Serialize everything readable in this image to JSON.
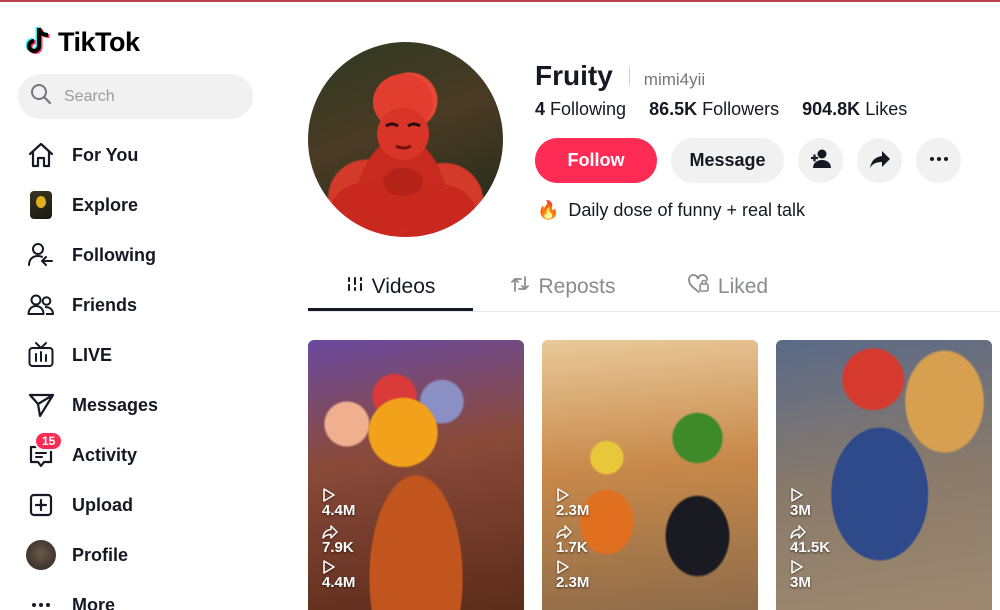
{
  "app": {
    "name": "TikTok",
    "brand_color": "#fe2c55"
  },
  "search": {
    "placeholder": "Search"
  },
  "sidebar": {
    "items": [
      {
        "label": "For You",
        "icon": "home-icon"
      },
      {
        "label": "Explore",
        "icon": "explore-thumbnail-icon"
      },
      {
        "label": "Following",
        "icon": "following-icon"
      },
      {
        "label": "Friends",
        "icon": "friends-icon"
      },
      {
        "label": "LIVE",
        "icon": "live-tv-icon"
      },
      {
        "label": "Messages",
        "icon": "messages-send-icon"
      },
      {
        "label": "Activity",
        "icon": "activity-inbox-icon",
        "badge": "15"
      },
      {
        "label": "Upload",
        "icon": "upload-plus-icon"
      },
      {
        "label": "Profile",
        "icon": "profile-avatar-icon"
      },
      {
        "label": "More",
        "icon": "more-dots-icon"
      }
    ]
  },
  "profile": {
    "name": "Fruity",
    "handle": "mimi4yii",
    "stats": [
      {
        "value": "4",
        "label": "Following"
      },
      {
        "value": "86.5K",
        "label": "Followers"
      },
      {
        "value": "904.8K",
        "label": "Likes"
      }
    ],
    "follow_label": "Follow",
    "message_label": "Message",
    "bio": "Daily dose of funny + real talk",
    "bio_emoji": "🔥"
  },
  "tabs": [
    {
      "label": "Videos",
      "active": true
    },
    {
      "label": "Reposts",
      "active": false
    },
    {
      "label": "Liked",
      "active": false
    }
  ],
  "videos": [
    {
      "views": "4.4M",
      "shares": "7.9K",
      "views_repeat": "4.4M"
    },
    {
      "views": "2.3M",
      "shares": "1.7K",
      "views_repeat": "2.3M"
    },
    {
      "views": "3M",
      "shares": "41.5K",
      "views_repeat": "3M"
    }
  ]
}
